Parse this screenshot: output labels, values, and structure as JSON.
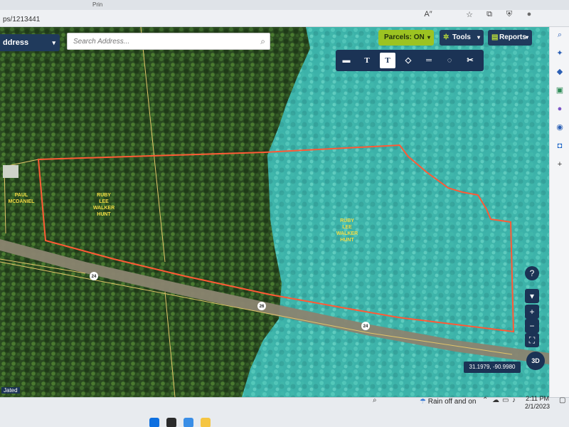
{
  "browser": {
    "url": "ps/1213441",
    "tab_fragment_1": "Prin",
    "icons": [
      "read-aloud-icon",
      "favorites-icon",
      "collections-icon",
      "shield-icon",
      "profile-icon"
    ],
    "icon_glyphs": [
      "A″",
      "☆",
      "⧉",
      "⛨",
      "●"
    ]
  },
  "map": {
    "address_label": "ddress",
    "search_placeholder": "Search Address...",
    "parcels_label": "Parcels: ON",
    "tools_label": "Tools",
    "reports_label": "Reports",
    "toolbar": [
      {
        "name": "imagery-tool",
        "glyph": "▬"
      },
      {
        "name": "text-tool",
        "glyph": "T"
      },
      {
        "name": "text-box-tool",
        "glyph": "T"
      },
      {
        "name": "polygon-tool",
        "glyph": "◇"
      },
      {
        "name": "line-tool",
        "glyph": "═"
      },
      {
        "name": "circle-tool",
        "glyph": "◌"
      },
      {
        "name": "scissors-tool",
        "glyph": "✂"
      }
    ],
    "labels": {
      "paul_1": "PAUL",
      "paul_2": "MCDANIEL",
      "ruby_west_1": "RUBY",
      "ruby_west_2": "LEE",
      "ruby_west_3": "WALKER",
      "ruby_west_4": "HUNT",
      "ruby_east_1": "RUBY",
      "ruby_east_2": "LEE",
      "ruby_east_3": "WALKER",
      "ruby_east_4": "HUNT",
      "road_1": "24",
      "road_2": "26",
      "road_3": "24"
    },
    "help": "?",
    "layers": "▾",
    "zoom_in": "+",
    "zoom_out": "−",
    "fullscreen": "⛶",
    "three_d": "3D",
    "coords": "31.1979, -90.9980",
    "bottom_left_tag": "Jated",
    "colors": {
      "boundary": "#ff5a36",
      "water": "#3fc4c0",
      "forest": "#2c4d22",
      "parcel_line": "#e2c46a"
    }
  },
  "taskbar": {
    "weather_text": "Rain off and on",
    "time": "2:11 PM",
    "date": "2/1/2023"
  }
}
